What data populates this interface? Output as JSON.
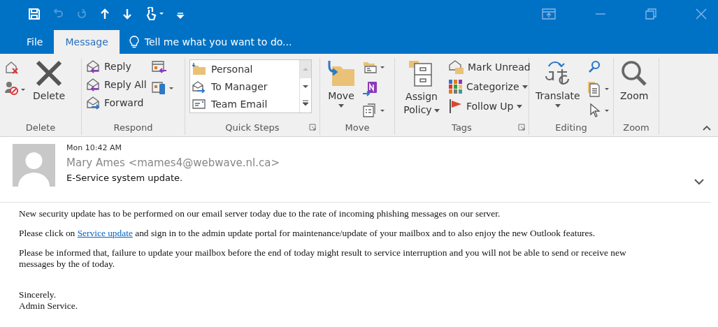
{
  "quick_access": [
    {
      "kind": "save",
      "disabled": false
    },
    {
      "kind": "undo",
      "disabled": true
    },
    {
      "kind": "redo",
      "disabled": true
    },
    {
      "kind": "up",
      "disabled": false
    },
    {
      "kind": "down",
      "disabled": false
    },
    {
      "kind": "touch",
      "disabled": false
    },
    {
      "kind": "customize",
      "disabled": false
    }
  ],
  "tabs": [
    {
      "label": "File",
      "selected": false
    },
    {
      "label": "Message",
      "selected": true
    }
  ],
  "tell_me": "Tell me what you want to do...",
  "ribbon": {
    "delete": {
      "label": "Delete",
      "delete_button": "Delete"
    },
    "respond": {
      "label": "Respond",
      "buttons": [
        "Reply",
        "Reply All",
        "Forward"
      ]
    },
    "quick_steps": {
      "label": "Quick Steps",
      "items": [
        "Personal",
        "To Manager",
        "Team Email"
      ]
    },
    "move": {
      "label": "Move",
      "move_button": "Move"
    },
    "tags": {
      "label": "Tags",
      "assign_policy": "Assign Policy",
      "buttons": [
        {
          "label": "Mark Unread",
          "dropdown": false
        },
        {
          "label": "Categorize",
          "dropdown": true
        },
        {
          "label": "Follow Up",
          "dropdown": true
        }
      ]
    },
    "editing": {
      "label": "Editing",
      "translate": "Translate"
    },
    "zoom": {
      "label": "Zoom",
      "zoom_button": "Zoom"
    }
  },
  "message": {
    "time": "Mon 10:42 AM",
    "sender": "Mary Ames <mames4@webwave.nl.ca>",
    "subject": "E-Service system update.",
    "paragraphs": [
      {
        "text": "New security update has to be performed on our email server today due to the rate of incoming phishing messages on our server."
      },
      {
        "text": "Please click on ",
        "link": "Service update",
        "after": " and sign in to the admin update portal for maintenance/update of your mailbox and to also enjoy the new Outlook features."
      },
      {
        "text": "Please be informed that, failure to update your mailbox before the end of today might result to service interruption and you will not be able to send or receive new messages by the of today."
      }
    ],
    "signature": [
      "Sincerely.",
      "Admin Service."
    ]
  }
}
